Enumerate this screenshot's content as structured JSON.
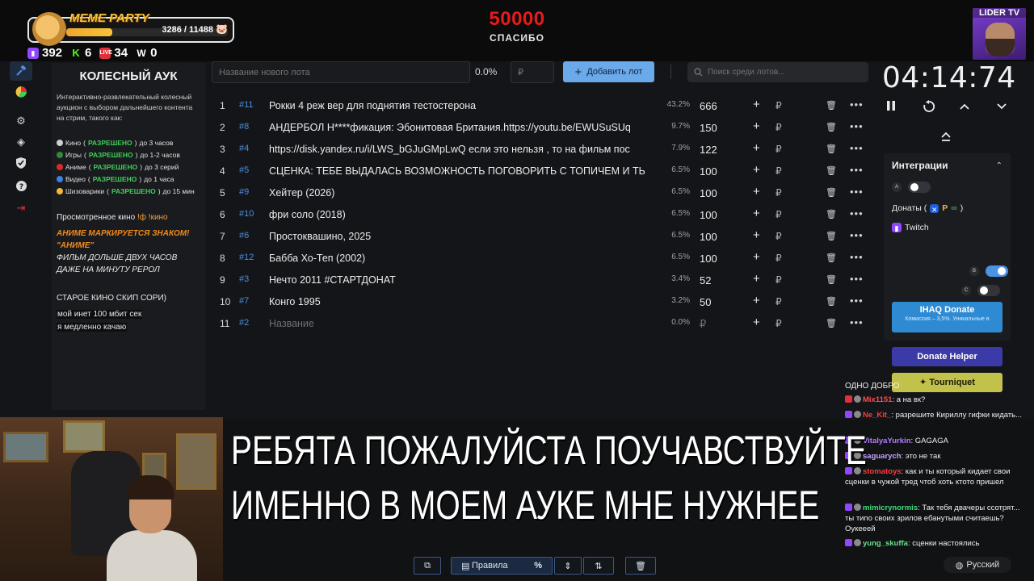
{
  "overlay": {
    "meme_title": "MEME PARTY",
    "meme_progress": "3286 / 11488",
    "meme_fraction": 0.286,
    "counter_value": "50000",
    "counter_sub": "СПАСИБО",
    "channel_badge": "LIDER TV",
    "stats": [
      {
        "icon": "twitch-icon",
        "value": "392",
        "color": "#9146ff"
      },
      {
        "icon": "kick-icon",
        "value": "6",
        "color": "#53fc18"
      },
      {
        "icon": "vk-live-icon",
        "value": "34",
        "color": "#e0303a"
      },
      {
        "icon": "w-icon",
        "value": "0",
        "color": "#ffffff"
      }
    ],
    "caption_line1": "РЕБЯТА ПОЖАЛУЙСТА ПОУЧАВСТВУЙТЕ",
    "caption_line2": "ИМЕННО В МОЕМ АУКЕ МНЕ НУЖНЕЕ"
  },
  "rail": [
    "hammer-icon",
    "pie-chart-icon",
    "gear-icon",
    "layers-icon",
    "shield-icon",
    "help-icon",
    "logout-icon"
  ],
  "description": {
    "title": "КОЛЕСНЫЙ АУК",
    "intro": "Интерактивно-развлекательный колесный аукцион с выбором дальнейшего контента на стрим, такого как:",
    "rules": [
      {
        "name": "Кино",
        "status": "РАЗРЕШЕНО",
        "limit": " до 3 часов",
        "color": "#cfcfcf"
      },
      {
        "name": "Игры",
        "status": "РАЗРЕШЕНО",
        "limit": " до 1-2 часов",
        "color": "#2f8a3a"
      },
      {
        "name": "Аниме",
        "status": "РАЗРЕШЕНО",
        "limit": " до 3 серий",
        "color": "#d62b2b"
      },
      {
        "name": "Видео",
        "status": "РАЗРЕШЕНО",
        "limit": " до 1 часа",
        "color": "#3e7fe0"
      },
      {
        "name": "Шизоварики",
        "status": "РАЗРЕШЕНО",
        "limit": " до 15 мин",
        "color": "#f0b93a"
      }
    ],
    "watched_label": "Просмотренное кино",
    "watched_cmd": " !ф !кино",
    "anime_note": "АНИМЕ МАРКИРУЕТСЯ ЗНАКОМ! \"АНИМЕ\"",
    "long_note": "ФИЛЬМ ДОЛЬШЕ ДВУХ ЧАСОВ ДАЖЕ НА МИНУТУ РЕРОЛ",
    "skip_note": "СТАРОЕ КИНО СКИП СОРИ)",
    "net_line1": "мой инет 100 мбит сек",
    "net_line2": "я медленно качаю"
  },
  "toolbar": {
    "lot_placeholder": "Название нового лота",
    "percent": "0.0%",
    "amount_placeholder": "₽",
    "add_label": "Добавить лот",
    "search_placeholder": "Поиск среди лотов..."
  },
  "lots": [
    {
      "n": "1",
      "id": "#11",
      "name": "Рокки 4 реж вер для поднятия тестостерона",
      "pct": "43.2%",
      "amount": "666"
    },
    {
      "n": "2",
      "id": "#8",
      "name": "АНДЕРБОЛ Н****фикация: Эбонитовая Британия.https://youtu.be/EWUSuSUq",
      "pct": "9.7%",
      "amount": "150"
    },
    {
      "n": "3",
      "id": "#4",
      "name": "https://disk.yandex.ru/i/LWS_bGJuGMpLwQ  если это нельзя , то на фильм пос",
      "pct": "7.9%",
      "amount": "122"
    },
    {
      "n": "4",
      "id": "#5",
      "name": "СЦЕНКА: ТЕБЕ ВЫДАЛАСЬ ВОЗМОЖНОСТЬ ПОГОВОРИТЬ С ТОПИЧЕМ И ТЬ",
      "pct": "6.5%",
      "amount": "100"
    },
    {
      "n": "5",
      "id": "#9",
      "name": "Хейтер (2026)",
      "pct": "6.5%",
      "amount": "100"
    },
    {
      "n": "6",
      "id": "#10",
      "name": " фри соло (2018)",
      "pct": "6.5%",
      "amount": "100"
    },
    {
      "n": "7",
      "id": "#6",
      "name": "Простоквашино, 2025",
      "pct": "6.5%",
      "amount": "100"
    },
    {
      "n": "8",
      "id": "#12",
      "name": "Бабба Хо-Теп (2002)",
      "pct": "6.5%",
      "amount": "100"
    },
    {
      "n": "9",
      "id": "#3",
      "name": "Нечто 2011 #СТАРТДОНАТ",
      "pct": "3.4%",
      "amount": "52"
    },
    {
      "n": "10",
      "id": "#7",
      "name": "Конго 1995",
      "pct": "3.2%",
      "amount": "50"
    },
    {
      "n": "11",
      "id": "#2",
      "name": "Название",
      "pct": "0.0%",
      "amount": "₽",
      "placeholder": true
    }
  ],
  "timer": {
    "value": "04:14:74"
  },
  "integrations": {
    "title": "Интеграции",
    "key_a": "A",
    "donations_label": "Донаты (",
    "donations_close": ")",
    "key_b": "B",
    "twitch_label": "Twitch",
    "key_c": "C",
    "ihaq_label": "IHAQ Donate",
    "ihaq_sub": "Комиссия – 3,5%. Уникальные в",
    "donate_helper_label": "Donate Helper",
    "tourniquet_label": "Tourniquet"
  },
  "chat": {
    "header": "ОДНО ДОБРО",
    "messages": [
      {
        "user": "Mix1151",
        "text": " а на вк?",
        "color": "#ff4d4d",
        "badge": "#e0303a"
      },
      {
        "user": "Ne_Kit_",
        "text": " разрешите Кириллу гифки кидать...",
        "color": "#ff3b3b",
        "badge": "#9146ff"
      },
      {
        "user": "VitalyaYurkin",
        "text": " GAGAGA",
        "color": "#b37cff",
        "badge": "#9146ff"
      },
      {
        "user": "saguarych",
        "text": " это не так",
        "color": "#c7a4ff",
        "badge": "#9146ff"
      },
      {
        "user": "stomatoys",
        "text": " как и ты который кидает свои сценки в чужой тред чтоб хоть ктото пришел",
        "color": "#ff3b3b",
        "badge": "#9146ff"
      },
      {
        "user": "mimicrynormis",
        "text": " Так тебя двачеры ссотрят... ты типо своих зрилов ебанутыми считаешь? Оукееей",
        "color": "#3be07b",
        "badge": "#9146ff"
      },
      {
        "user": "yung_skuffa",
        "text": " сценки настоялись",
        "color": "#65e08a",
        "badge": "#9146ff"
      }
    ]
  },
  "bottom": {
    "rules_label": "Правила",
    "language": "Русский"
  }
}
